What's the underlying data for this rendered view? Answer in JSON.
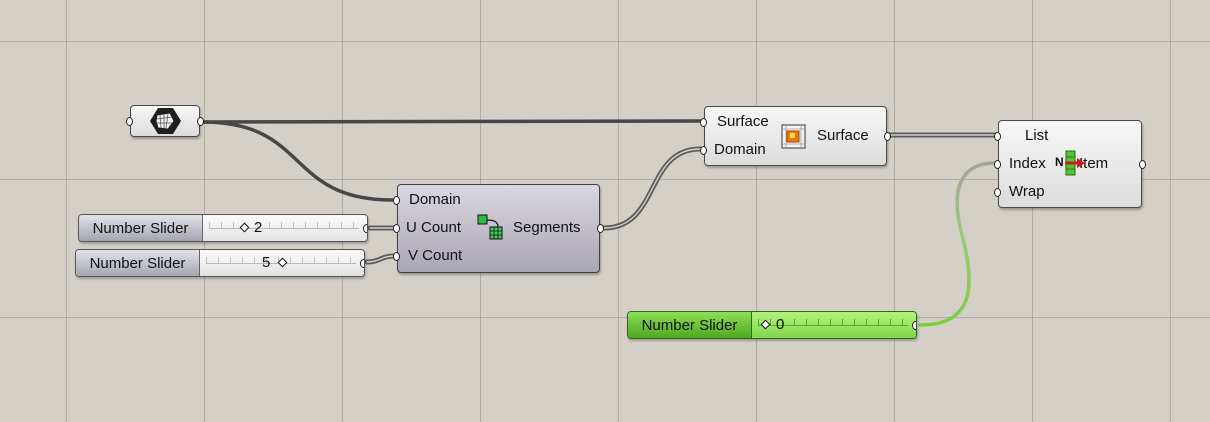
{
  "canvas": {
    "background": "#d4d0c8",
    "grid_color": "#96928a"
  },
  "surface_param": {
    "icon": "surface-parameter-icon"
  },
  "divide_domain": {
    "inputs": [
      "Domain",
      "U Count",
      "V Count"
    ],
    "outputs": [
      "Segments"
    ],
    "icon": "divide-domain2-icon"
  },
  "isotrim": {
    "inputs": [
      "Surface",
      "Domain"
    ],
    "outputs": [
      "Surface"
    ],
    "icon": "isotrim-icon"
  },
  "list_item": {
    "inputs": [
      "List",
      "Index",
      "Wrap"
    ],
    "outputs": [
      "Item"
    ],
    "icon": "list-item-icon",
    "icon_letter": "N"
  },
  "sliders": [
    {
      "label": "Number Slider",
      "value": "2",
      "position": 0.3
    },
    {
      "label": "Number Slider",
      "value": "5",
      "position": 0.5
    },
    {
      "label": "Number Slider",
      "value": "0",
      "position": 0.0,
      "color": "#7fd84a"
    }
  ]
}
